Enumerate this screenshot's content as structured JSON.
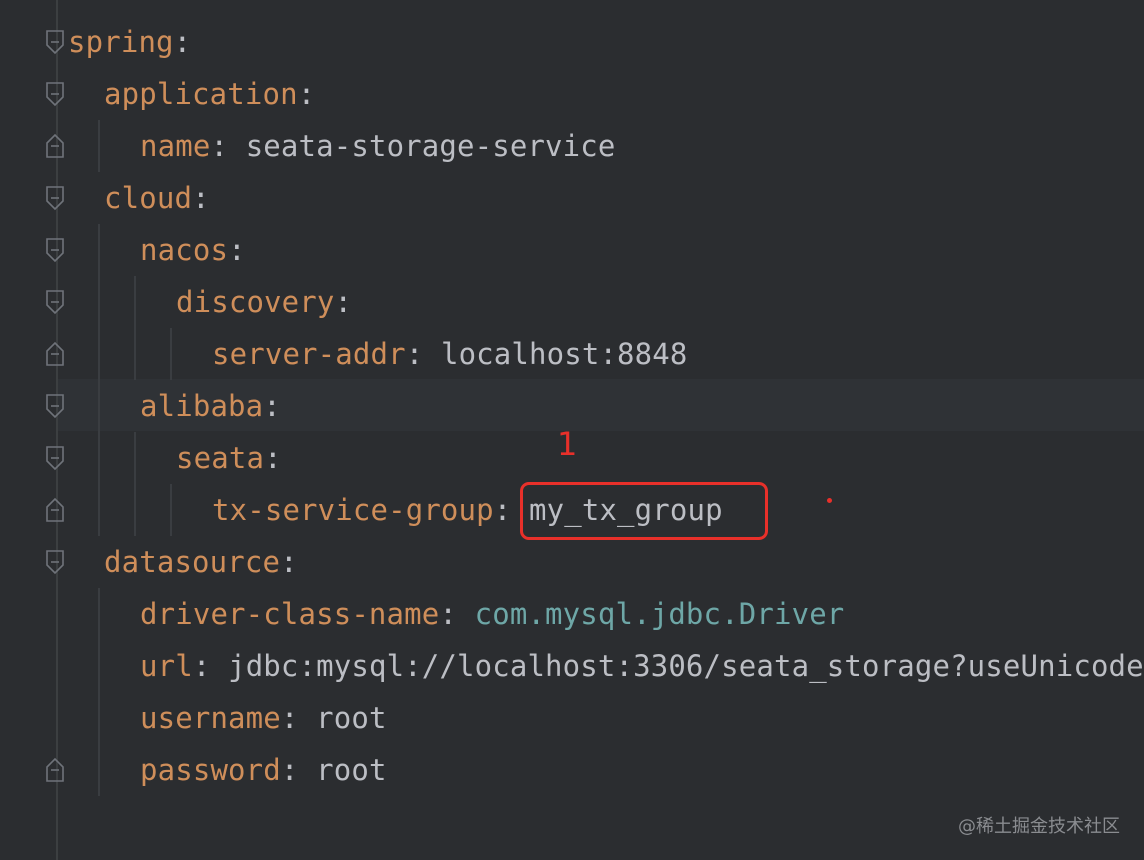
{
  "editor": {
    "lines": [
      {
        "key": "spring",
        "sep": ":",
        "value": "",
        "value_kind": "plain"
      },
      {
        "key": "application",
        "sep": ":",
        "value": "",
        "value_kind": "plain"
      },
      {
        "key": "name",
        "sep": ": ",
        "value": "seata-storage-service",
        "value_kind": "plain"
      },
      {
        "key": "cloud",
        "sep": ":",
        "value": "",
        "value_kind": "plain"
      },
      {
        "key": "nacos",
        "sep": ":",
        "value": "",
        "value_kind": "plain"
      },
      {
        "key": "discovery",
        "sep": ":",
        "value": "",
        "value_kind": "plain"
      },
      {
        "key": "server-addr",
        "sep": ": ",
        "value": "localhost:8848",
        "value_kind": "plain"
      },
      {
        "key": "alibaba",
        "sep": ":",
        "value": "",
        "value_kind": "plain"
      },
      {
        "key": "seata",
        "sep": ":",
        "value": "",
        "value_kind": "plain"
      },
      {
        "key": "tx-service-group",
        "sep": ": ",
        "value": "my_tx_group",
        "value_kind": "plain"
      },
      {
        "key": "datasource",
        "sep": ":",
        "value": "",
        "value_kind": "plain"
      },
      {
        "key": "driver-class-name",
        "sep": ": ",
        "value": "com.mysql.jdbc.Driver",
        "value_kind": "class"
      },
      {
        "key": "url",
        "sep": ": ",
        "value": "jdbc:mysql://localhost:3306/seata_storage?useUnicode",
        "value_kind": "plain"
      },
      {
        "key": "username",
        "sep": ": ",
        "value": "root",
        "value_kind": "plain"
      },
      {
        "key": "password",
        "sep": ": ",
        "value": "root",
        "value_kind": "plain"
      }
    ]
  },
  "annotation": {
    "number": "1",
    "color": "#e8302a"
  },
  "watermark": "@稀土掘金技术社区",
  "colors": {
    "background": "#2b2d30",
    "key": "#cf8e5a",
    "value": "#bcbec4",
    "class_value": "#6ea7a7"
  }
}
